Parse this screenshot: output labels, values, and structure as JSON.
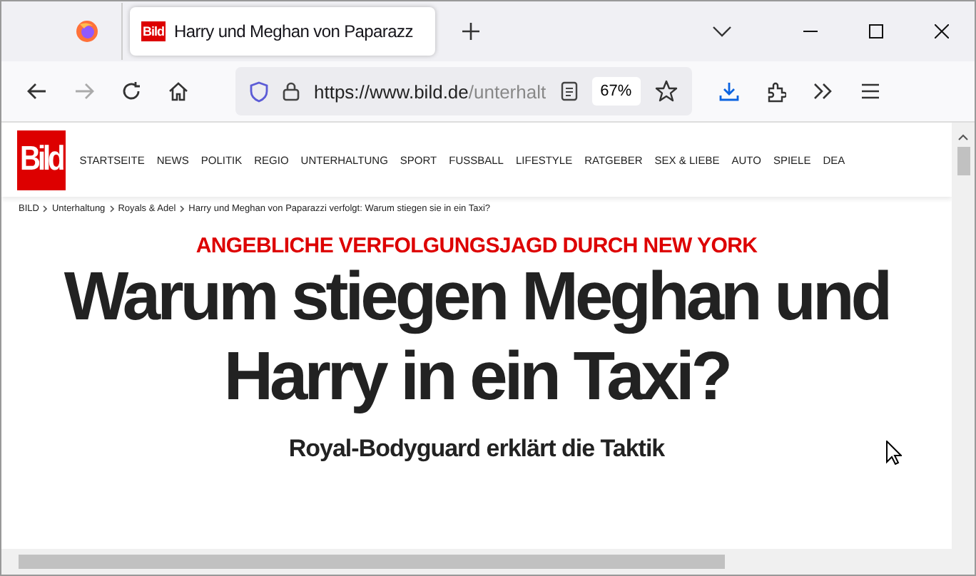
{
  "tab": {
    "title": "Harry und Meghan von Paparazz",
    "logo": "Bild",
    "selected": true
  },
  "toolbar": {
    "url_host": "https://www.bild.de",
    "url_path": "/unterhalt",
    "zoom": "67%"
  },
  "site": {
    "logo": "Bild",
    "nav": [
      "STARTSEITE",
      "NEWS",
      "POLITIK",
      "REGIO",
      "UNTERHALTUNG",
      "SPORT",
      "FUSSBALL",
      "LIFESTYLE",
      "RATGEBER",
      "SEX & LIEBE",
      "AUTO",
      "SPIELE",
      "DEA"
    ]
  },
  "breadcrumb": [
    "BILD",
    "Unterhaltung",
    "Royals & Adel",
    "Harry und Meghan von Paparazzi verfolgt: Warum stiegen sie in ein Taxi?"
  ],
  "article": {
    "kicker": "ANGEBLICHE VERFOLGUNGSJAGD DURCH NEW YORK",
    "headline": [
      "Warum stiegen Meghan und",
      "Harry in ein Taxi?"
    ],
    "subheadline": "Royal-Bodyguard erklärt die Taktik"
  }
}
